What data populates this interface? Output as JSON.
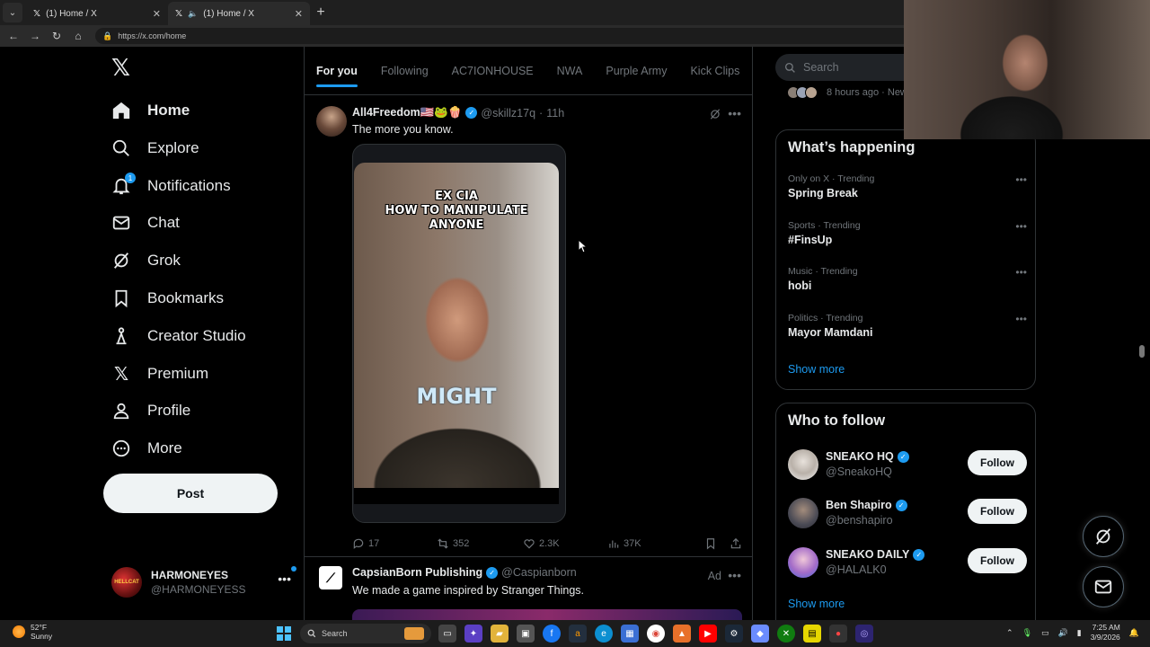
{
  "browser": {
    "tabs": [
      {
        "title": "(1) Home / X",
        "active": false
      },
      {
        "title": "(1) Home / X",
        "active": true
      }
    ],
    "url": "https://x.com/home"
  },
  "nav": {
    "items": [
      {
        "label": "Home",
        "icon": "home-icon"
      },
      {
        "label": "Explore",
        "icon": "search-icon"
      },
      {
        "label": "Notifications",
        "icon": "bell-icon",
        "badge": "1"
      },
      {
        "label": "Chat",
        "icon": "mail-icon"
      },
      {
        "label": "Grok",
        "icon": "grok-icon"
      },
      {
        "label": "Bookmarks",
        "icon": "bookmark-icon"
      },
      {
        "label": "Creator Studio",
        "icon": "creator-studio-icon"
      },
      {
        "label": "Premium",
        "icon": "x-premium-icon"
      },
      {
        "label": "Profile",
        "icon": "person-icon"
      },
      {
        "label": "More",
        "icon": "more-circle-icon"
      }
    ],
    "post_label": "Post",
    "account": {
      "name": "HARMONEYES",
      "handle": "@HARMONEYESS",
      "avatar_text": "HELLCAT"
    }
  },
  "feed": {
    "tabs": [
      "For you",
      "Following",
      "AC7IONHOUSE",
      "NWA",
      "Purple Army",
      "Kick Clips"
    ],
    "tweet1": {
      "name": "All4Freedom🇺🇸🐸🍿",
      "handle": "@skillz17q",
      "sep": "·",
      "time": "11h",
      "text": "The more you know.",
      "video_caption_top": "EX CIA\nHOW TO MANIPULATE\nANYONE",
      "video_caption_mid": "MIGHT",
      "replies": "17",
      "reposts": "352",
      "likes": "2.3K",
      "views": "37K"
    },
    "tweet2": {
      "name": "CapsianBorn Publishing",
      "handle": "@Caspianborn",
      "ad": "Ad",
      "text": "We made a game inspired by Stranger Things."
    }
  },
  "sidebar": {
    "search_placeholder": "Search",
    "strip_text": "8 hours ago · New",
    "happening_title": "What’s happening",
    "trends": [
      {
        "meta": "Only on X · Trending",
        "name": "Spring Break"
      },
      {
        "meta": "Sports · Trending",
        "name": "#FinsUp"
      },
      {
        "meta": "Music · Trending",
        "name": "hobi"
      },
      {
        "meta": "Politics · Trending",
        "name": "Mayor Mamdani"
      }
    ],
    "show_more": "Show more",
    "follow_title": "Who to follow",
    "who": [
      {
        "name": "SNEAKO HQ",
        "handle": "@SneakoHQ"
      },
      {
        "name": "Ben Shapiro",
        "handle": "@benshapiro"
      },
      {
        "name": "SNEAKO DAILY",
        "handle": "@HALALK0"
      }
    ],
    "follow_label": "Follow",
    "show_more_follow": "Show more"
  },
  "taskbar": {
    "weather_temp": "52°F",
    "weather_desc": "Sunny",
    "search_label": "Search",
    "time": "7:25 AM",
    "date": "3/9/2026"
  },
  "colors": {
    "accent": "#1d9bf0",
    "background": "#000000",
    "border": "#2f3336",
    "muted": "#71767b"
  }
}
